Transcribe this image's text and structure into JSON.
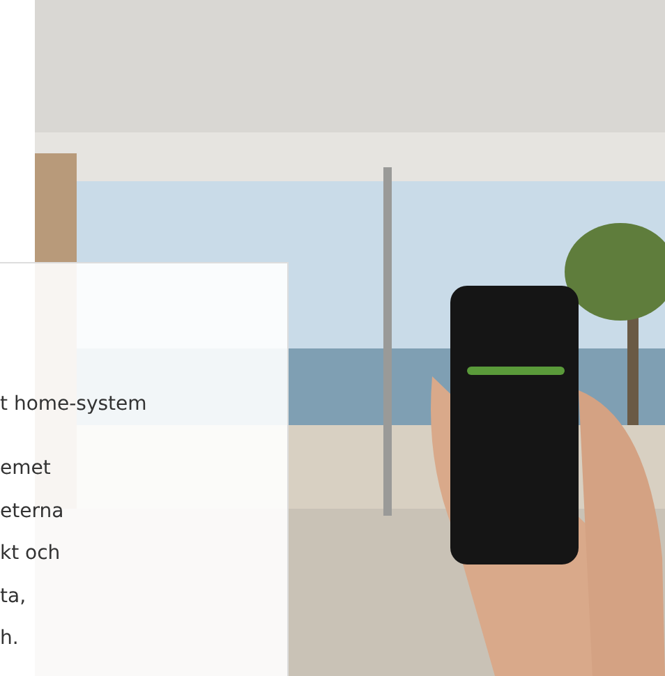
{
  "card": {
    "heading": "t home-system",
    "paragraph": "emet\neterna\nkt och\nta,\nh."
  }
}
